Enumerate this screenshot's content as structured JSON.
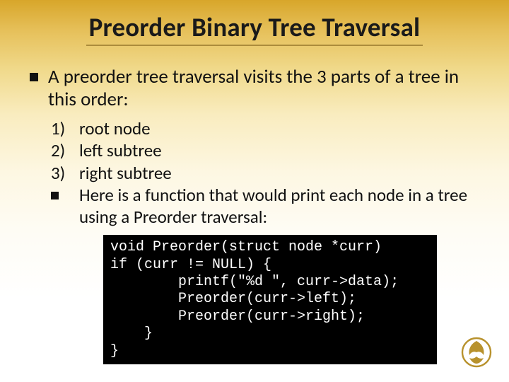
{
  "title": "Preorder Binary Tree Traversal",
  "intro": "A preorder tree traversal visits the 3 parts of a tree in this order:",
  "items": [
    {
      "num": "1)",
      "text": "root node"
    },
    {
      "num": "2)",
      "text": "left subtree"
    },
    {
      "num": "3)",
      "text": "right subtree"
    }
  ],
  "note": "Here is a function that would print each node in a tree using a Preorder traversal:",
  "code": "void Preorder(struct node *curr)\nif (curr != NULL) {\n        printf(\"%d \", curr->data);\n        Preorder(curr->left);\n        Preorder(curr->right);\n    }\n}",
  "logo_name": "ucf-pegasus-logo"
}
